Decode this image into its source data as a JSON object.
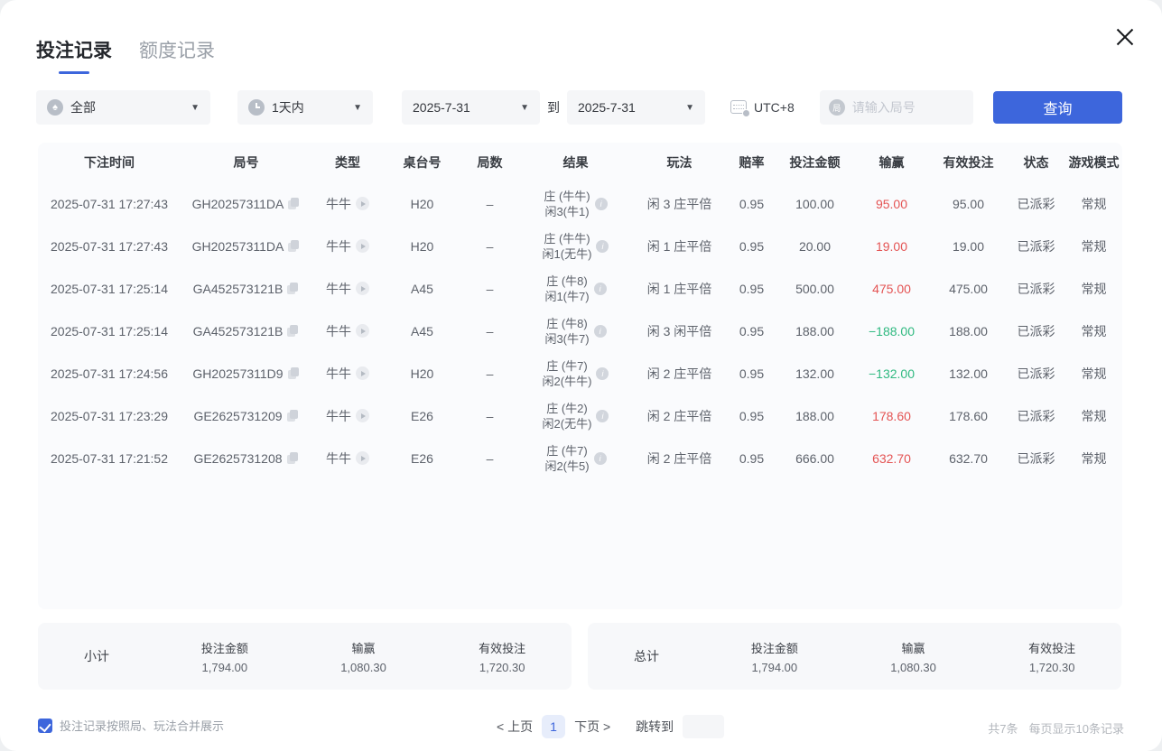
{
  "colors": {
    "accent_blue": "#3d66dc",
    "loss_red": "#e45454",
    "win_green": "#2fb980",
    "table_bg": "#fafbfd"
  },
  "tabs": {
    "bet_records": "投注记录",
    "quota_records": "额度记录"
  },
  "filters": {
    "game_select": {
      "value": "全部",
      "icon": "spade-icon"
    },
    "range_select": {
      "value": "1天内",
      "icon": "clock-icon"
    },
    "date_from": "2025-7-31",
    "to_label": "到",
    "date_to": "2025-7-31",
    "timezone": "UTC+8",
    "round_input": {
      "placeholder": "请输入局号",
      "icon_char": "局"
    },
    "search_button": "查询"
  },
  "table": {
    "headers": [
      "下注时间",
      "局号",
      "类型",
      "桌台号",
      "局数",
      "结果",
      "玩法",
      "赔率",
      "投注金额",
      "输赢",
      "有效投注",
      "状态",
      "游戏模式"
    ],
    "rows": [
      {
        "time": "2025-07-31 17:27:43",
        "round": "GH20257311DA",
        "type": "牛牛",
        "table_no": "H20",
        "rounds": "–",
        "result1": "庄 (牛牛)",
        "result2": "闲3(牛1)",
        "play": "闲 3 庄平倍",
        "odds": "0.95",
        "amount": "100.00",
        "winloss": "95.00",
        "win": true,
        "valid": "95.00",
        "status": "已派彩",
        "mode": "常规"
      },
      {
        "time": "2025-07-31 17:27:43",
        "round": "GH20257311DA",
        "type": "牛牛",
        "table_no": "H20",
        "rounds": "–",
        "result1": "庄 (牛牛)",
        "result2": "闲1(无牛)",
        "play": "闲 1 庄平倍",
        "odds": "0.95",
        "amount": "20.00",
        "winloss": "19.00",
        "win": true,
        "valid": "19.00",
        "status": "已派彩",
        "mode": "常规"
      },
      {
        "time": "2025-07-31 17:25:14",
        "round": "GA452573121B",
        "type": "牛牛",
        "table_no": "A45",
        "rounds": "–",
        "result1": "庄 (牛8)",
        "result2": "闲1(牛7)",
        "play": "闲 1 庄平倍",
        "odds": "0.95",
        "amount": "500.00",
        "winloss": "475.00",
        "win": true,
        "valid": "475.00",
        "status": "已派彩",
        "mode": "常规"
      },
      {
        "time": "2025-07-31 17:25:14",
        "round": "GA452573121B",
        "type": "牛牛",
        "table_no": "A45",
        "rounds": "–",
        "result1": "庄 (牛8)",
        "result2": "闲3(牛7)",
        "play": "闲 3 闲平倍",
        "odds": "0.95",
        "amount": "188.00",
        "winloss": "−188.00",
        "win": false,
        "valid": "188.00",
        "status": "已派彩",
        "mode": "常规"
      },
      {
        "time": "2025-07-31 17:24:56",
        "round": "GH20257311D9",
        "type": "牛牛",
        "table_no": "H20",
        "rounds": "–",
        "result1": "庄 (牛7)",
        "result2": "闲2(牛牛)",
        "play": "闲 2 庄平倍",
        "odds": "0.95",
        "amount": "132.00",
        "winloss": "−132.00",
        "win": false,
        "valid": "132.00",
        "status": "已派彩",
        "mode": "常规"
      },
      {
        "time": "2025-07-31 17:23:29",
        "round": "GE2625731209",
        "type": "牛牛",
        "table_no": "E26",
        "rounds": "–",
        "result1": "庄 (牛2)",
        "result2": "闲2(无牛)",
        "play": "闲 2 庄平倍",
        "odds": "0.95",
        "amount": "188.00",
        "winloss": "178.60",
        "win": true,
        "valid": "178.60",
        "status": "已派彩",
        "mode": "常规"
      },
      {
        "time": "2025-07-31 17:21:52",
        "round": "GE2625731208",
        "type": "牛牛",
        "table_no": "E26",
        "rounds": "–",
        "result1": "庄 (牛7)",
        "result2": "闲2(牛5)",
        "play": "闲 2 庄平倍",
        "odds": "0.95",
        "amount": "666.00",
        "winloss": "632.70",
        "win": true,
        "valid": "632.70",
        "status": "已派彩",
        "mode": "常规"
      }
    ]
  },
  "summary": {
    "subtotal": {
      "label": "小计",
      "cols": [
        {
          "label": "投注金额",
          "value": "1,794.00",
          "red": false
        },
        {
          "label": "输赢",
          "value": "1,080.30",
          "red": true
        },
        {
          "label": "有效投注",
          "value": "1,720.30",
          "red": false
        }
      ]
    },
    "total": {
      "label": "总计",
      "cols": [
        {
          "label": "投注金额",
          "value": "1,794.00",
          "red": false
        },
        {
          "label": "输赢",
          "value": "1,080.30",
          "red": true
        },
        {
          "label": "有效投注",
          "value": "1,720.30",
          "red": false
        }
      ]
    }
  },
  "footer": {
    "merge_checkbox": {
      "checked": true,
      "label": "投注记录按照局、玩法合并展示"
    },
    "pagination": {
      "prev": "< 上页",
      "current": "1",
      "next": "下页 >",
      "jump_label": "跳转到"
    },
    "stats_total": "共7条",
    "stats_pagesize": "每页显示10条记录"
  }
}
